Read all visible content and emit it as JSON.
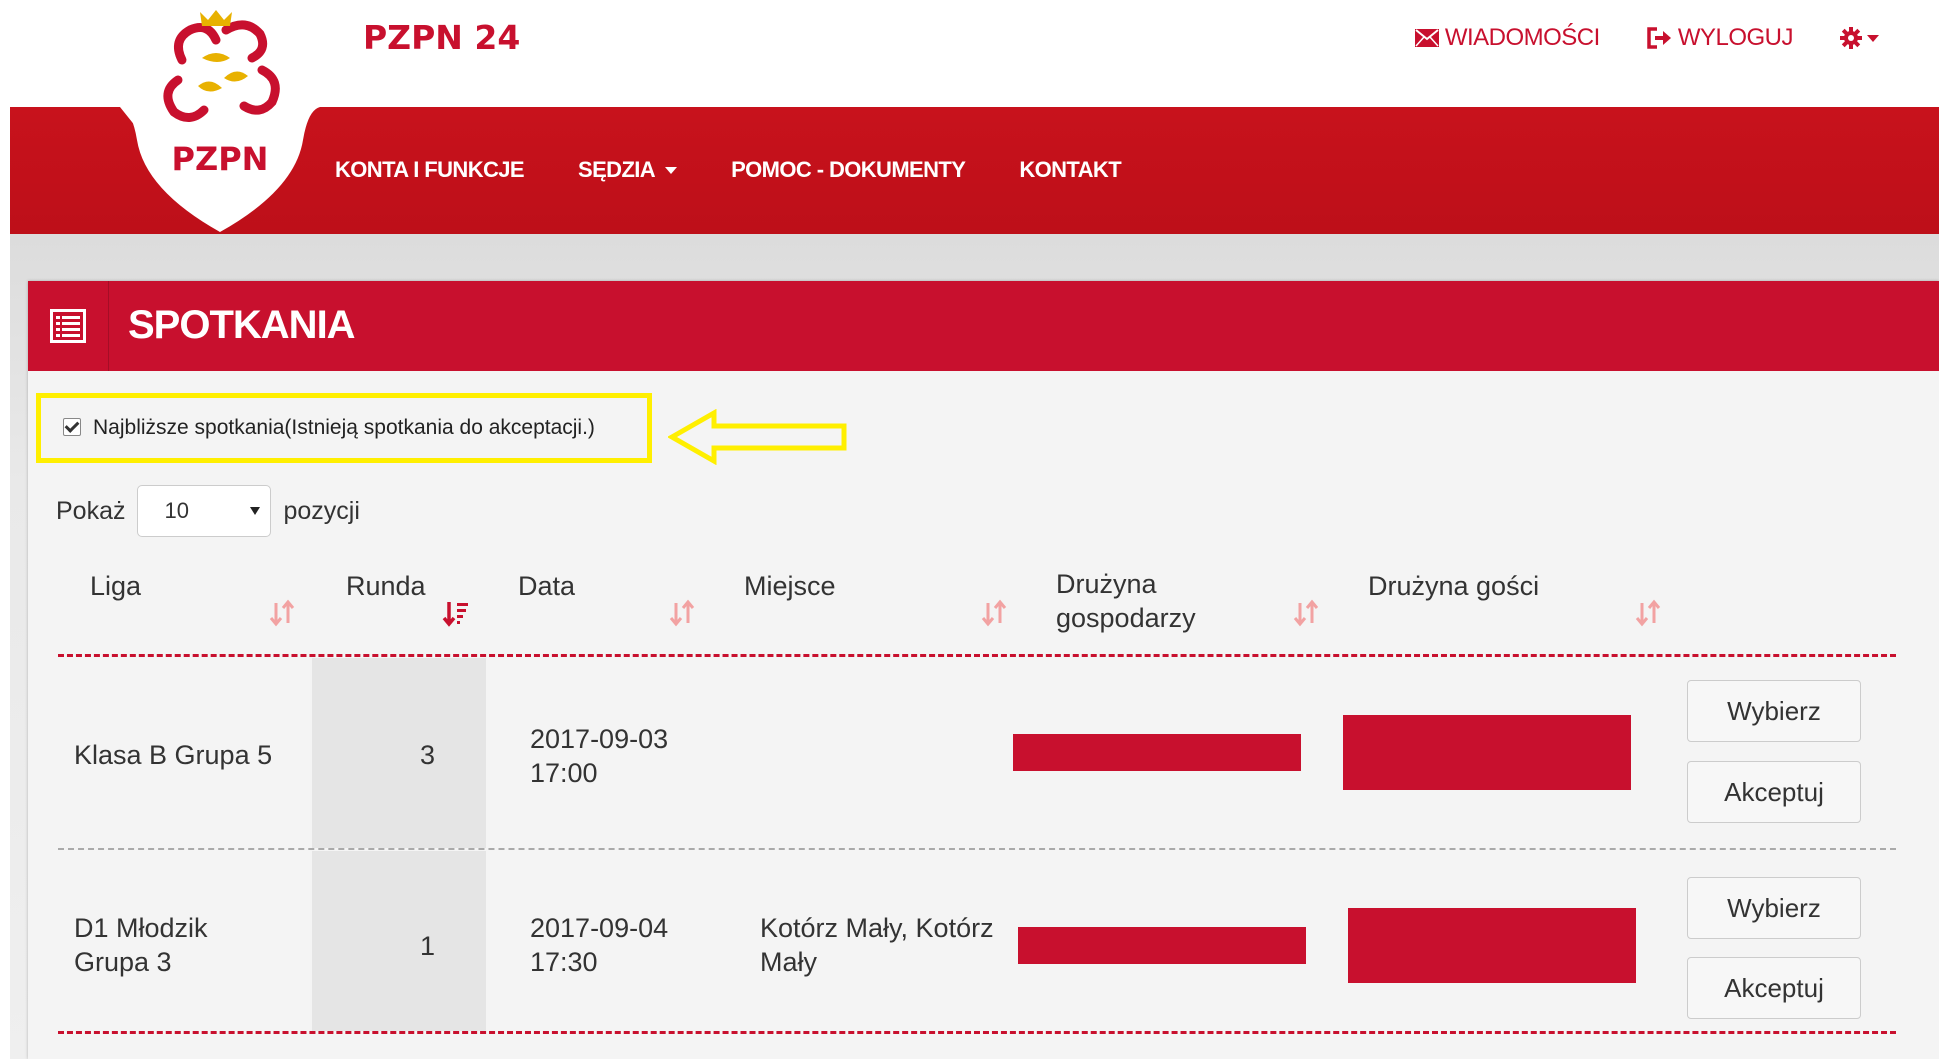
{
  "brand": {
    "logo_text": "PZPN",
    "title": "PZPN 24"
  },
  "top_links": {
    "messages": "WIADOMOŚCI",
    "logout": "WYLOGUJ"
  },
  "nav": {
    "accounts": "KONTA I FUNKCJE",
    "referee": "SĘDZIA",
    "help": "POMOC - DOKUMENTY",
    "contact": "KONTAKT"
  },
  "panel": {
    "title": "SPOTKANIA"
  },
  "filter": {
    "label": "Najbliższe spotkania(Istnieją spotkania do akceptacji.)",
    "checked": true
  },
  "length_menu": {
    "prefix": "Pokaż",
    "value": "10",
    "suffix": "pozycji"
  },
  "table": {
    "headers": {
      "liga": "Liga",
      "runda": "Runda",
      "data": "Data",
      "miejsce": "Miejsce",
      "home_line1": "Drużyna",
      "home_line2": "gospodarzy",
      "away": "Drużyna gości"
    },
    "rows": [
      {
        "liga_line1": "Klasa B Grupa 5",
        "liga_line2": "",
        "runda": "3",
        "date": "2017-09-03",
        "time": "17:00",
        "miejsce_line1": "",
        "miejsce_line2": "",
        "select": "Wybierz",
        "accept": "Akceptuj"
      },
      {
        "liga_line1": "D1 Młodzik",
        "liga_line2": "Grupa 3",
        "runda": "1",
        "date": "2017-09-04",
        "time": "17:30",
        "miejsce_line1": "Kotórz Mały, Kotórz",
        "miejsce_line2": "Mały",
        "select": "Wybierz",
        "accept": "Akceptuj"
      }
    ]
  },
  "colors": {
    "brand_red": "#c8102e",
    "highlight": "#ffef00",
    "background": "#efefef"
  }
}
